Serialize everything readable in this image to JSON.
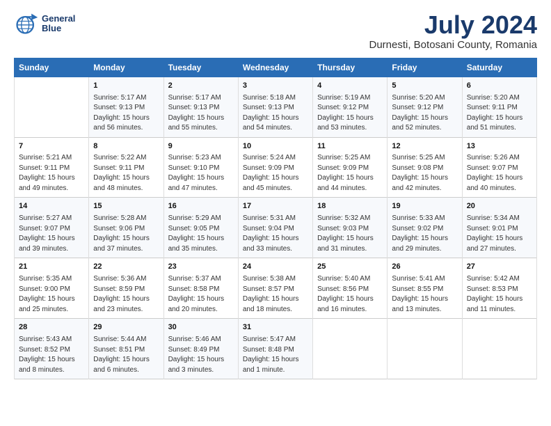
{
  "logo": {
    "line1": "General",
    "line2": "Blue"
  },
  "title": "July 2024",
  "subtitle": "Durnesti, Botosani County, Romania",
  "weekdays": [
    "Sunday",
    "Monday",
    "Tuesday",
    "Wednesday",
    "Thursday",
    "Friday",
    "Saturday"
  ],
  "weeks": [
    [
      {
        "day": "",
        "content": ""
      },
      {
        "day": "1",
        "content": "Sunrise: 5:17 AM\nSunset: 9:13 PM\nDaylight: 15 hours\nand 56 minutes."
      },
      {
        "day": "2",
        "content": "Sunrise: 5:17 AM\nSunset: 9:13 PM\nDaylight: 15 hours\nand 55 minutes."
      },
      {
        "day": "3",
        "content": "Sunrise: 5:18 AM\nSunset: 9:13 PM\nDaylight: 15 hours\nand 54 minutes."
      },
      {
        "day": "4",
        "content": "Sunrise: 5:19 AM\nSunset: 9:12 PM\nDaylight: 15 hours\nand 53 minutes."
      },
      {
        "day": "5",
        "content": "Sunrise: 5:20 AM\nSunset: 9:12 PM\nDaylight: 15 hours\nand 52 minutes."
      },
      {
        "day": "6",
        "content": "Sunrise: 5:20 AM\nSunset: 9:11 PM\nDaylight: 15 hours\nand 51 minutes."
      }
    ],
    [
      {
        "day": "7",
        "content": "Sunrise: 5:21 AM\nSunset: 9:11 PM\nDaylight: 15 hours\nand 49 minutes."
      },
      {
        "day": "8",
        "content": "Sunrise: 5:22 AM\nSunset: 9:11 PM\nDaylight: 15 hours\nand 48 minutes."
      },
      {
        "day": "9",
        "content": "Sunrise: 5:23 AM\nSunset: 9:10 PM\nDaylight: 15 hours\nand 47 minutes."
      },
      {
        "day": "10",
        "content": "Sunrise: 5:24 AM\nSunset: 9:09 PM\nDaylight: 15 hours\nand 45 minutes."
      },
      {
        "day": "11",
        "content": "Sunrise: 5:25 AM\nSunset: 9:09 PM\nDaylight: 15 hours\nand 44 minutes."
      },
      {
        "day": "12",
        "content": "Sunrise: 5:25 AM\nSunset: 9:08 PM\nDaylight: 15 hours\nand 42 minutes."
      },
      {
        "day": "13",
        "content": "Sunrise: 5:26 AM\nSunset: 9:07 PM\nDaylight: 15 hours\nand 40 minutes."
      }
    ],
    [
      {
        "day": "14",
        "content": "Sunrise: 5:27 AM\nSunset: 9:07 PM\nDaylight: 15 hours\nand 39 minutes."
      },
      {
        "day": "15",
        "content": "Sunrise: 5:28 AM\nSunset: 9:06 PM\nDaylight: 15 hours\nand 37 minutes."
      },
      {
        "day": "16",
        "content": "Sunrise: 5:29 AM\nSunset: 9:05 PM\nDaylight: 15 hours\nand 35 minutes."
      },
      {
        "day": "17",
        "content": "Sunrise: 5:31 AM\nSunset: 9:04 PM\nDaylight: 15 hours\nand 33 minutes."
      },
      {
        "day": "18",
        "content": "Sunrise: 5:32 AM\nSunset: 9:03 PM\nDaylight: 15 hours\nand 31 minutes."
      },
      {
        "day": "19",
        "content": "Sunrise: 5:33 AM\nSunset: 9:02 PM\nDaylight: 15 hours\nand 29 minutes."
      },
      {
        "day": "20",
        "content": "Sunrise: 5:34 AM\nSunset: 9:01 PM\nDaylight: 15 hours\nand 27 minutes."
      }
    ],
    [
      {
        "day": "21",
        "content": "Sunrise: 5:35 AM\nSunset: 9:00 PM\nDaylight: 15 hours\nand 25 minutes."
      },
      {
        "day": "22",
        "content": "Sunrise: 5:36 AM\nSunset: 8:59 PM\nDaylight: 15 hours\nand 23 minutes."
      },
      {
        "day": "23",
        "content": "Sunrise: 5:37 AM\nSunset: 8:58 PM\nDaylight: 15 hours\nand 20 minutes."
      },
      {
        "day": "24",
        "content": "Sunrise: 5:38 AM\nSunset: 8:57 PM\nDaylight: 15 hours\nand 18 minutes."
      },
      {
        "day": "25",
        "content": "Sunrise: 5:40 AM\nSunset: 8:56 PM\nDaylight: 15 hours\nand 16 minutes."
      },
      {
        "day": "26",
        "content": "Sunrise: 5:41 AM\nSunset: 8:55 PM\nDaylight: 15 hours\nand 13 minutes."
      },
      {
        "day": "27",
        "content": "Sunrise: 5:42 AM\nSunset: 8:53 PM\nDaylight: 15 hours\nand 11 minutes."
      }
    ],
    [
      {
        "day": "28",
        "content": "Sunrise: 5:43 AM\nSunset: 8:52 PM\nDaylight: 15 hours\nand 8 minutes."
      },
      {
        "day": "29",
        "content": "Sunrise: 5:44 AM\nSunset: 8:51 PM\nDaylight: 15 hours\nand 6 minutes."
      },
      {
        "day": "30",
        "content": "Sunrise: 5:46 AM\nSunset: 8:49 PM\nDaylight: 15 hours\nand 3 minutes."
      },
      {
        "day": "31",
        "content": "Sunrise: 5:47 AM\nSunset: 8:48 PM\nDaylight: 15 hours\nand 1 minute."
      },
      {
        "day": "",
        "content": ""
      },
      {
        "day": "",
        "content": ""
      },
      {
        "day": "",
        "content": ""
      }
    ]
  ]
}
